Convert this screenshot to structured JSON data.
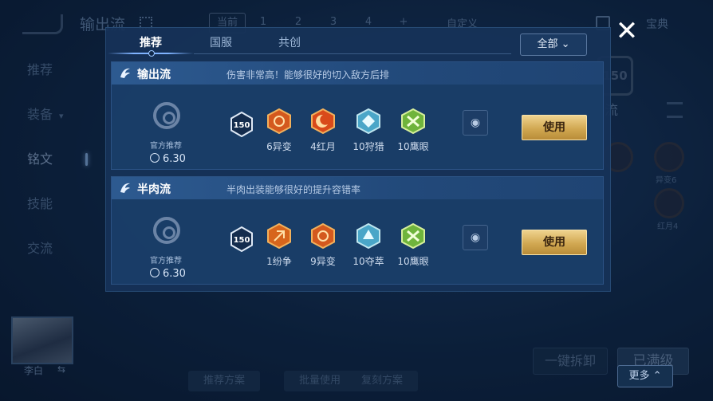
{
  "background": {
    "title": "输出流",
    "tabs": [
      "当前",
      "1",
      "2",
      "3",
      "4",
      "+"
    ],
    "custom": "自定义",
    "right_label": "宝典",
    "sidebar": [
      {
        "label": "推荐"
      },
      {
        "label": "装备"
      },
      {
        "label": "铭文"
      },
      {
        "label": "技能"
      },
      {
        "label": "交流"
      }
    ],
    "hero_name": "李白",
    "right_badge": "150",
    "right_title": "出流",
    "right_runes": [
      "异变6",
      "红月4"
    ],
    "onekey": "一键拆卸",
    "full": "已满级",
    "more": "更多",
    "bottom_tabs": [
      "推荐方案",
      "批量使用",
      "复刻方案"
    ]
  },
  "modal": {
    "tabs": [
      {
        "label": "推荐",
        "active": true
      },
      {
        "label": "国服",
        "active": false
      },
      {
        "label": "共创",
        "active": false
      }
    ],
    "filter": "全部",
    "close": "✕",
    "cards": [
      {
        "title": "输出流",
        "desc": "伤害非常高！能够很好的切入敌方后排",
        "official": "官方推荐",
        "version": "6.30",
        "level": "150",
        "runes": [
          {
            "label": "6异变",
            "color": "#d4591e"
          },
          {
            "label": "4红月",
            "color": "#d94a1a"
          },
          {
            "label": "10狩猎",
            "color": "#4aa6c8"
          },
          {
            "label": "10鹰眼",
            "color": "#6fb43c"
          }
        ],
        "use": "使用"
      },
      {
        "title": "半肉流",
        "desc": "半肉出装能够很好的提升容错率",
        "official": "官方推荐",
        "version": "6.30",
        "level": "150",
        "runes": [
          {
            "label": "1纷争",
            "color": "#d7651c"
          },
          {
            "label": "9异变",
            "color": "#d4591e"
          },
          {
            "label": "10夺萃",
            "color": "#4aa6c8"
          },
          {
            "label": "10鹰眼",
            "color": "#6fb43c"
          }
        ],
        "use": "使用"
      }
    ]
  }
}
